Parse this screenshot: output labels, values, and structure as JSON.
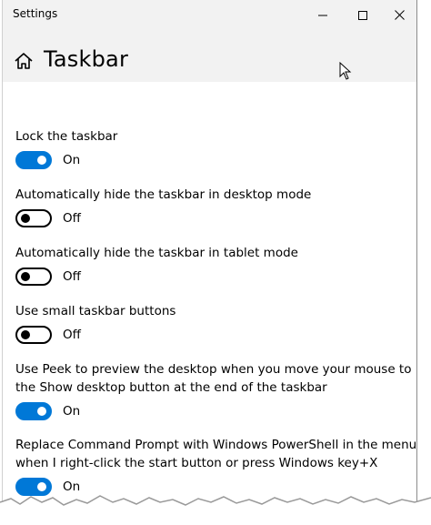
{
  "window": {
    "title": "Settings"
  },
  "header": {
    "title": "Taskbar"
  },
  "settings": [
    {
      "label": "Lock the taskbar",
      "state": "On",
      "on": true
    },
    {
      "label": "Automatically hide the taskbar in desktop mode",
      "state": "Off",
      "on": false
    },
    {
      "label": "Automatically hide the taskbar in tablet mode",
      "state": "Off",
      "on": false
    },
    {
      "label": "Use small taskbar buttons",
      "state": "Off",
      "on": false
    },
    {
      "label_line1": "Use Peek to preview the desktop when you move your mouse to",
      "label_line2": "the Show desktop button at the end of the taskbar",
      "state": "On",
      "on": true
    },
    {
      "label_line1": "Replace Command Prompt with Windows PowerShell in the menu",
      "label_line2": "when I right-click the start button or press Windows key+X",
      "state": "On",
      "on": true
    }
  ],
  "colors": {
    "accent": "#0078d7",
    "titlebar_bg": "#f2f2f2"
  },
  "icons": {
    "home": "home-icon",
    "minimize": "minimize-icon",
    "maximize": "maximize-icon",
    "close": "close-icon",
    "cursor": "mouse-pointer-icon"
  }
}
